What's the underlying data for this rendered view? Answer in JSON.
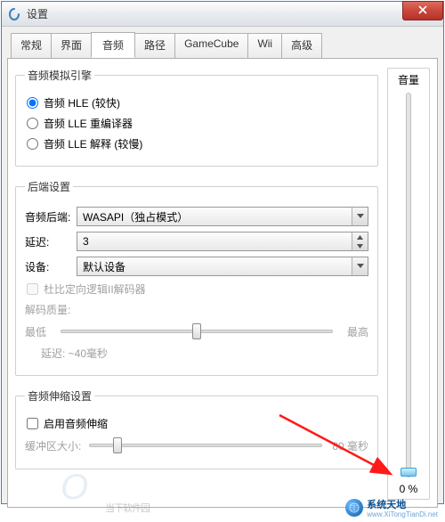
{
  "window": {
    "title": "设置"
  },
  "tabs": [
    "常规",
    "界面",
    "音频",
    "路径",
    "GameCube",
    "Wii",
    "高级"
  ],
  "active_tab_index": 2,
  "engine_group": {
    "legend": "音频模拟引擎",
    "options": [
      {
        "label": "音频 HLE (较快)"
      },
      {
        "label": "音频 LLE 重编译器"
      },
      {
        "label": "音频 LLE 解释 (较慢)"
      }
    ],
    "selected_index": 0
  },
  "backend_group": {
    "legend": "后端设置",
    "backend_label": "音频后端:",
    "backend_value": "WASAPI（独占模式）",
    "latency_label": "延迟:",
    "latency_value": "3",
    "device_label": "设备:",
    "device_value": "默认设备",
    "dpl2_label": "杜比定向逻辑II解码器",
    "quality_label": "解码质量:",
    "quality_low": "最低",
    "quality_high": "最高",
    "latency_readout": "延迟: ~40毫秒"
  },
  "stretch_group": {
    "legend": "音频伸缩设置",
    "enable_label": "启用音频伸缩",
    "buffer_label": "缓冲区大小:",
    "buffer_readout": "80 毫秒"
  },
  "volume": {
    "label": "音量",
    "value_text": "0 %",
    "value_percent": 0
  },
  "watermark_left": {
    "brand": "O",
    "sub": "当下软件园"
  },
  "watermark_right": {
    "zh": "系统天地",
    "en": "www.XiTongTianDi.net"
  }
}
